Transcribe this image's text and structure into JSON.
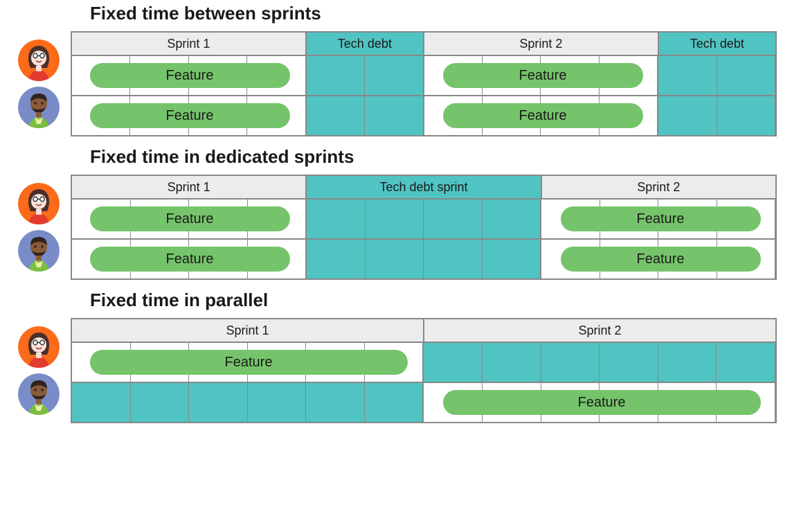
{
  "colors": {
    "teal": "#50c3c3",
    "green": "#75c46b",
    "header": "#ececec",
    "border": "#888",
    "avatar1": "#fb6b1a",
    "avatar2": "#7a8cc7"
  },
  "columns": 12,
  "sections": [
    {
      "title": "Fixed time between sprints",
      "columns": 12,
      "headers": [
        {
          "label": "Sprint 1",
          "span": 4,
          "teal": false
        },
        {
          "label": "Tech debt",
          "span": 2,
          "teal": true
        },
        {
          "label": "Sprint 2",
          "span": 4,
          "teal": false
        },
        {
          "label": "Tech debt",
          "span": 2,
          "teal": true
        }
      ],
      "rows": [
        {
          "person": "woman",
          "tealCols": [
            4,
            5,
            10,
            11
          ],
          "features": [
            {
              "label": "Feature",
              "start": 0.3,
              "end": 3.7
            },
            {
              "label": "Feature",
              "start": 6.3,
              "end": 9.7
            }
          ]
        },
        {
          "person": "man",
          "tealCols": [
            4,
            5,
            10,
            11
          ],
          "features": [
            {
              "label": "Feature",
              "start": 0.3,
              "end": 3.7
            },
            {
              "label": "Feature",
              "start": 6.3,
              "end": 9.7
            }
          ]
        }
      ],
      "edges": [
        4,
        6,
        10
      ]
    },
    {
      "title": "Fixed time in dedicated sprints",
      "columns": 12,
      "headers": [
        {
          "label": "Sprint 1",
          "span": 4,
          "teal": false
        },
        {
          "label": "Tech debt sprint",
          "span": 4,
          "teal": true
        },
        {
          "label": "Sprint 2",
          "span": 4,
          "teal": false
        }
      ],
      "rows": [
        {
          "person": "woman",
          "tealCols": [
            4,
            5,
            6,
            7
          ],
          "features": [
            {
              "label": "Feature",
              "start": 0.3,
              "end": 3.7
            },
            {
              "label": "Feature",
              "start": 8.3,
              "end": 11.7
            }
          ]
        },
        {
          "person": "man",
          "tealCols": [
            4,
            5,
            6,
            7
          ],
          "features": [
            {
              "label": "Feature",
              "start": 0.3,
              "end": 3.7
            },
            {
              "label": "Feature",
              "start": 8.3,
              "end": 11.7
            }
          ]
        }
      ],
      "edges": [
        4,
        8
      ]
    },
    {
      "title": "Fixed time in parallel",
      "columns": 12,
      "headers": [
        {
          "label": "Sprint 1",
          "span": 6,
          "teal": false
        },
        {
          "label": "Sprint 2",
          "span": 6,
          "teal": false
        }
      ],
      "rows": [
        {
          "person": "woman",
          "tealCols": [
            6,
            7,
            8,
            9,
            10,
            11
          ],
          "features": [
            {
              "label": "Feature",
              "start": 0.3,
              "end": 5.7
            }
          ]
        },
        {
          "person": "man",
          "tealCols": [
            0,
            1,
            2,
            3,
            4,
            5
          ],
          "features": [
            {
              "label": "Feature",
              "start": 6.3,
              "end": 11.7
            }
          ]
        }
      ],
      "edges": [
        6
      ]
    }
  ]
}
